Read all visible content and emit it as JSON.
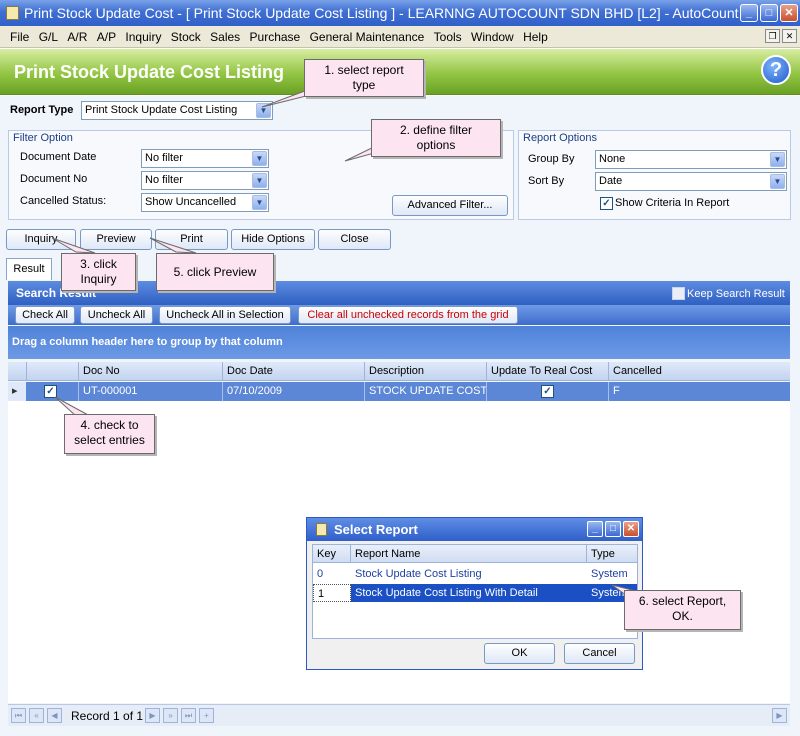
{
  "window": {
    "title": "Print Stock Update Cost - [ Print Stock Update Cost Listing ] - LEARNNG AUTOCOUNT SDN BHD [L2] - AutoCount ...",
    "controls": {
      "minimize": "_",
      "maximize": "□",
      "close": "✕"
    }
  },
  "menu": [
    "File",
    "G/L",
    "A/R",
    "A/P",
    "Inquiry",
    "Stock",
    "Sales",
    "Purchase",
    "General Maintenance",
    "Tools",
    "Window",
    "Help"
  ],
  "header": {
    "title": "Print Stock Update Cost Listing",
    "help_icon": "?"
  },
  "report_type": {
    "label": "Report Type",
    "value": "Print Stock Update Cost Listing"
  },
  "filter_option": {
    "title": "Filter Option",
    "document_date": {
      "label": "Document Date",
      "value": "No filter"
    },
    "document_no": {
      "label": "Document No",
      "value": "No filter"
    },
    "cancelled_status": {
      "label": "Cancelled Status:",
      "value": "Show Uncancelled"
    },
    "advanced_filter": "Advanced Filter..."
  },
  "report_options": {
    "title": "Report Options",
    "group_by": {
      "label": "Group By",
      "value": "None"
    },
    "sort_by": {
      "label": "Sort By",
      "value": "Date"
    },
    "show_criteria": {
      "label": "Show Criteria In Report",
      "checked": true
    }
  },
  "actions": {
    "inquiry": "Inquiry",
    "preview": "Preview",
    "print": "Print",
    "hide_options": "Hide Options",
    "close": "Close"
  },
  "tabs": {
    "result": "Result"
  },
  "search_result": {
    "title": "Search Result",
    "keep_search_result": "Keep Search Result",
    "check_all": "Check All",
    "uncheck_all": "Uncheck All",
    "uncheck_all_in_selection": "Uncheck All in Selection",
    "clear_unchecked": "Clear all unchecked records from the grid"
  },
  "grid": {
    "group_hint": "Drag a column header here to group by that column",
    "columns": [
      "Doc No",
      "Doc Date",
      "Description",
      "Update To Real Cost",
      "Cancelled"
    ],
    "rows": [
      {
        "checked": true,
        "doc_no": "UT-000001",
        "doc_date": "07/10/2009",
        "description": "STOCK UPDATE COST",
        "update_to_real_cost": true,
        "cancelled": "F"
      }
    ]
  },
  "navigator": {
    "record_text": "Record 1 of 1"
  },
  "dialog": {
    "title": "Select Report",
    "columns": [
      "Key",
      "Report Name",
      "Type"
    ],
    "rows": [
      {
        "key": "0",
        "name": "Stock Update Cost Listing",
        "type": "System"
      },
      {
        "key": "1",
        "name": "Stock Update Cost Listing With Detail",
        "type": "System"
      }
    ],
    "ok": "OK",
    "cancel": "Cancel"
  },
  "callouts": {
    "c1": "1. select report\ntype",
    "c2": "2. define filter\noptions",
    "c3": "3. click\nInquiry",
    "c4": "4. check to\nselect entries",
    "c5": "5. click Preview",
    "c6": "6. select Report,\nOK."
  },
  "colors": {
    "title_blue": "#3161c8",
    "header_green": "#6aa224",
    "callout_pink": "#fce4f0",
    "selection_blue": "#1a50c4",
    "clear_text_red": "#cc0000"
  }
}
